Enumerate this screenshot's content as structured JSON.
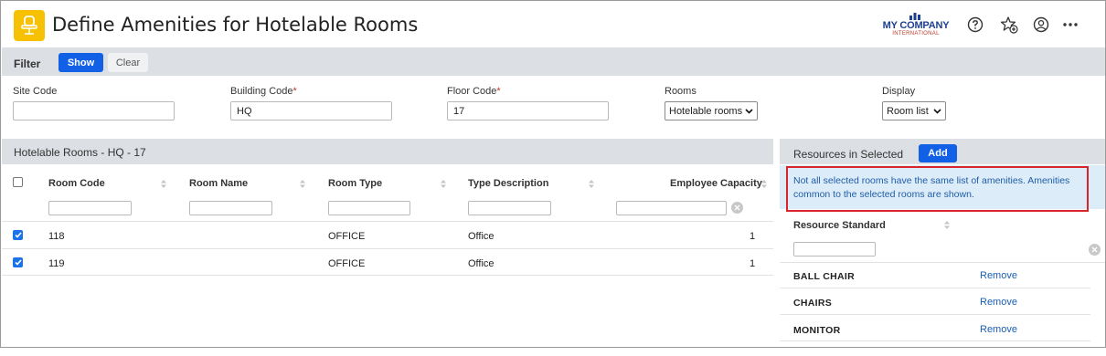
{
  "header": {
    "title": "Define Amenities for Hotelable Rooms",
    "app_icon": "chair-icon",
    "logo": {
      "name": "MY COMPANY",
      "sub": "INTERNATIONAL"
    },
    "icons": [
      "help-icon",
      "favorite-add-icon",
      "user-account-icon",
      "more-icon"
    ]
  },
  "filter": {
    "label": "Filter",
    "show_label": "Show",
    "clear_label": "Clear",
    "fields": [
      {
        "label": "Site Code",
        "required": false,
        "value": ""
      },
      {
        "label": "Building Code",
        "required": true,
        "value": "HQ"
      },
      {
        "label": "Floor Code",
        "required": true,
        "value": "17"
      }
    ],
    "rooms": {
      "label": "Rooms",
      "selected": "Hotelable rooms"
    },
    "display": {
      "label": "Display",
      "selected": "Room list"
    }
  },
  "rooms_grid": {
    "title": "Hotelable Rooms - HQ - 17",
    "columns": [
      "Room Code",
      "Room Name",
      "Room Type",
      "Type Description",
      "Employee Capacity"
    ],
    "rows": [
      {
        "checked": true,
        "room_code": "118",
        "room_name": "",
        "room_type": "OFFICE",
        "type_description": "Office",
        "employee_capacity": "1"
      },
      {
        "checked": true,
        "room_code": "119",
        "room_name": "",
        "room_type": "OFFICE",
        "type_description": "Office",
        "employee_capacity": "1"
      }
    ]
  },
  "resources": {
    "title": "Resources in Selected",
    "add_label": "Add",
    "notice": "Not all selected rooms have the same list of amenities. Amenities common to the selected rooms are shown.",
    "column": "Resource Standard",
    "remove_label": "Remove",
    "items": [
      "BALL CHAIR",
      "CHAIRS",
      "MONITOR"
    ]
  },
  "colors": {
    "accent": "#1260e6",
    "app_icon_bg": "#f6c100",
    "notice_bg": "#dcecf8",
    "notice_border": "#d9242b",
    "link": "#1a5fb4"
  }
}
